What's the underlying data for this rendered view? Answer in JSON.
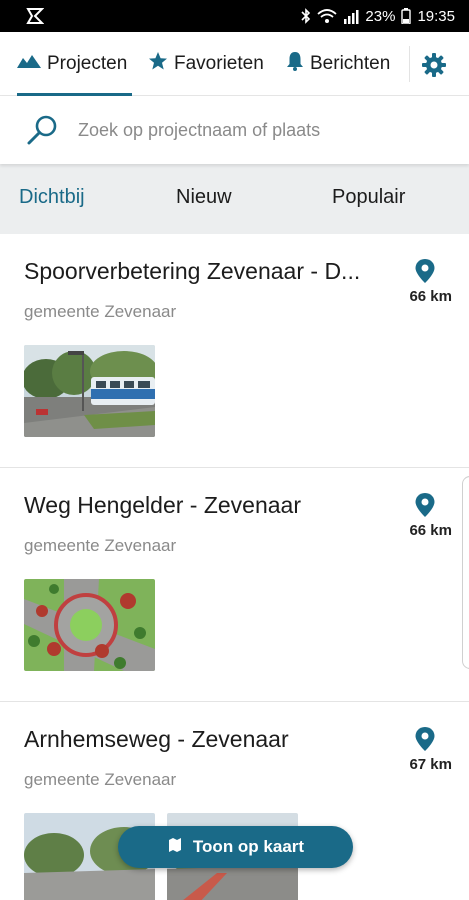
{
  "statusbar": {
    "battery": "23%",
    "time": "19:35"
  },
  "tabs": [
    {
      "label": "Projecten",
      "icon": "mountains-icon"
    },
    {
      "label": "Favorieten",
      "icon": "star-icon"
    },
    {
      "label": "Berichten",
      "icon": "bell-icon"
    }
  ],
  "settings_icon": "gear-icon",
  "search": {
    "placeholder": "Zoek op projectnaam of plaats"
  },
  "filters": [
    "Dichtbij",
    "Nieuw",
    "Populair"
  ],
  "projects": [
    {
      "title": "Spoorverbetering Zevenaar - D...",
      "municipality": "gemeente Zevenaar",
      "distance": "66 km"
    },
    {
      "title": "Weg Hengelder - Zevenaar",
      "municipality": "gemeente Zevenaar",
      "distance": "66 km"
    },
    {
      "title": "Arnhemseweg - Zevenaar",
      "municipality": "gemeente Zevenaar",
      "distance": "67 km"
    }
  ],
  "map_button": {
    "label": "Toon op kaart"
  },
  "colors": {
    "accent": "#1a6a88",
    "filter_bg": "#eceeef"
  }
}
